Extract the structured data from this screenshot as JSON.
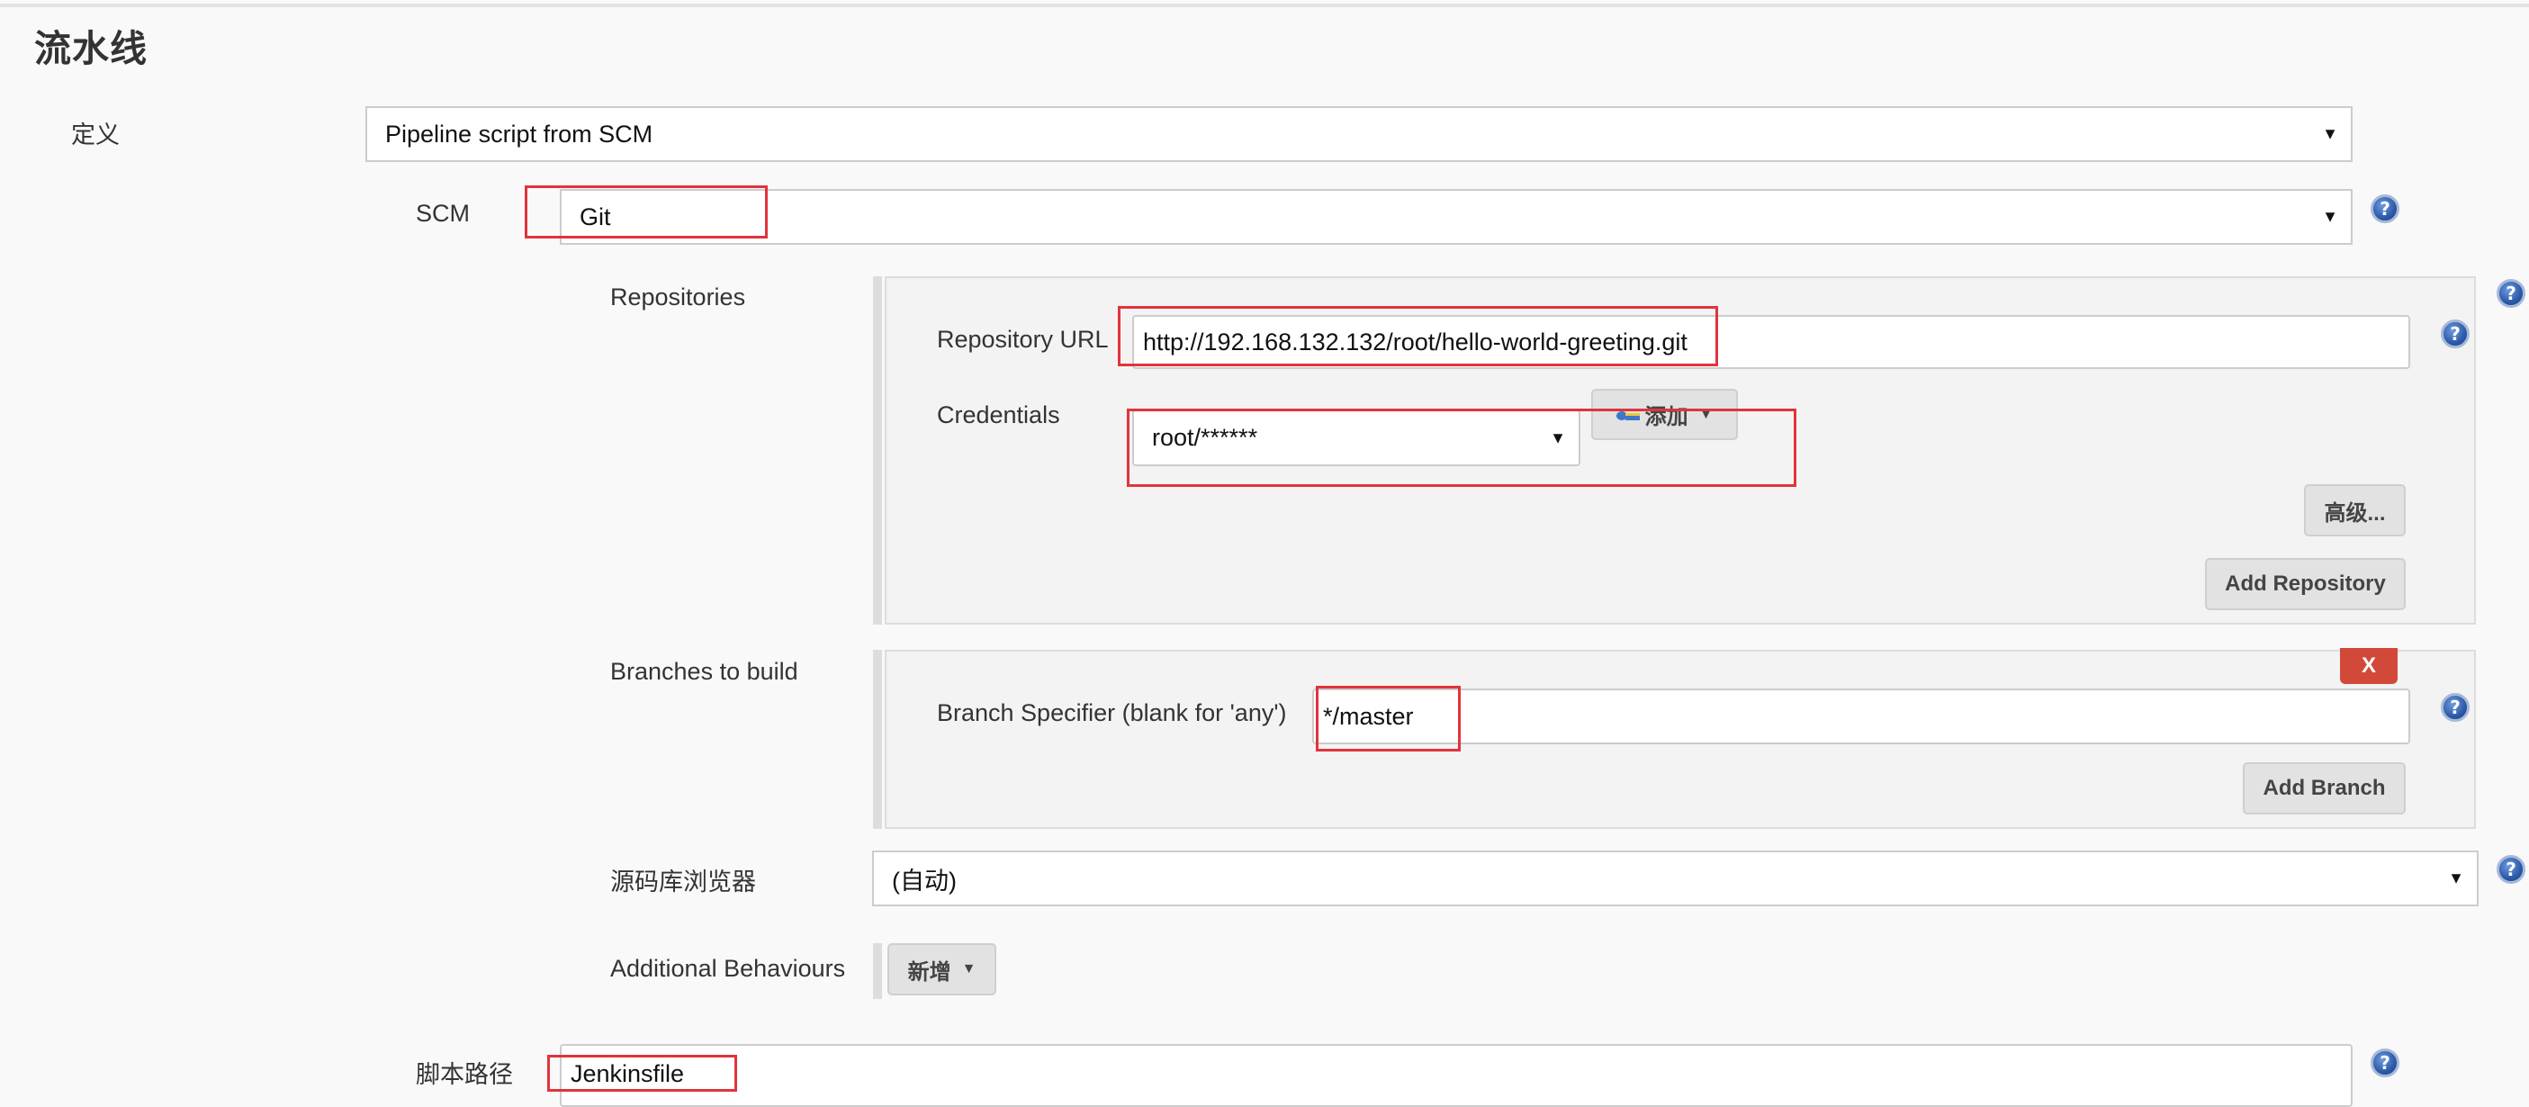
{
  "section": {
    "title": "流水线"
  },
  "definition": {
    "label": "定义",
    "selected": "Pipeline script from SCM"
  },
  "scm": {
    "label": "SCM",
    "selected": "Git"
  },
  "repositories": {
    "label": "Repositories",
    "repository_url_label": "Repository URL",
    "repository_url_value": "http://192.168.132.132/root/hello-world-greeting.git",
    "credentials_label": "Credentials",
    "credentials_selected": "root/******",
    "add_credentials_button": "添加",
    "advanced_button": "高级...",
    "add_repository_button": "Add Repository"
  },
  "branches": {
    "label": "Branches to build",
    "delete_button": "X",
    "branch_specifier_label": "Branch Specifier (blank for 'any')",
    "branch_specifier_value": "*/master",
    "add_branch_button": "Add Branch"
  },
  "repo_browser": {
    "label": "源码库浏览器",
    "selected": "(自动)"
  },
  "additional_behaviours": {
    "label": "Additional Behaviours",
    "add_button": "新增"
  },
  "script_path": {
    "label": "脚本路径",
    "value": "Jenkinsfile"
  },
  "icons": {
    "help": "?",
    "dropdown_arrow": "▼",
    "caret": "▼"
  },
  "colors": {
    "highlight_box": "#e0343c",
    "delete_button": "#d24939",
    "help_icon": "#2c5aa8"
  }
}
